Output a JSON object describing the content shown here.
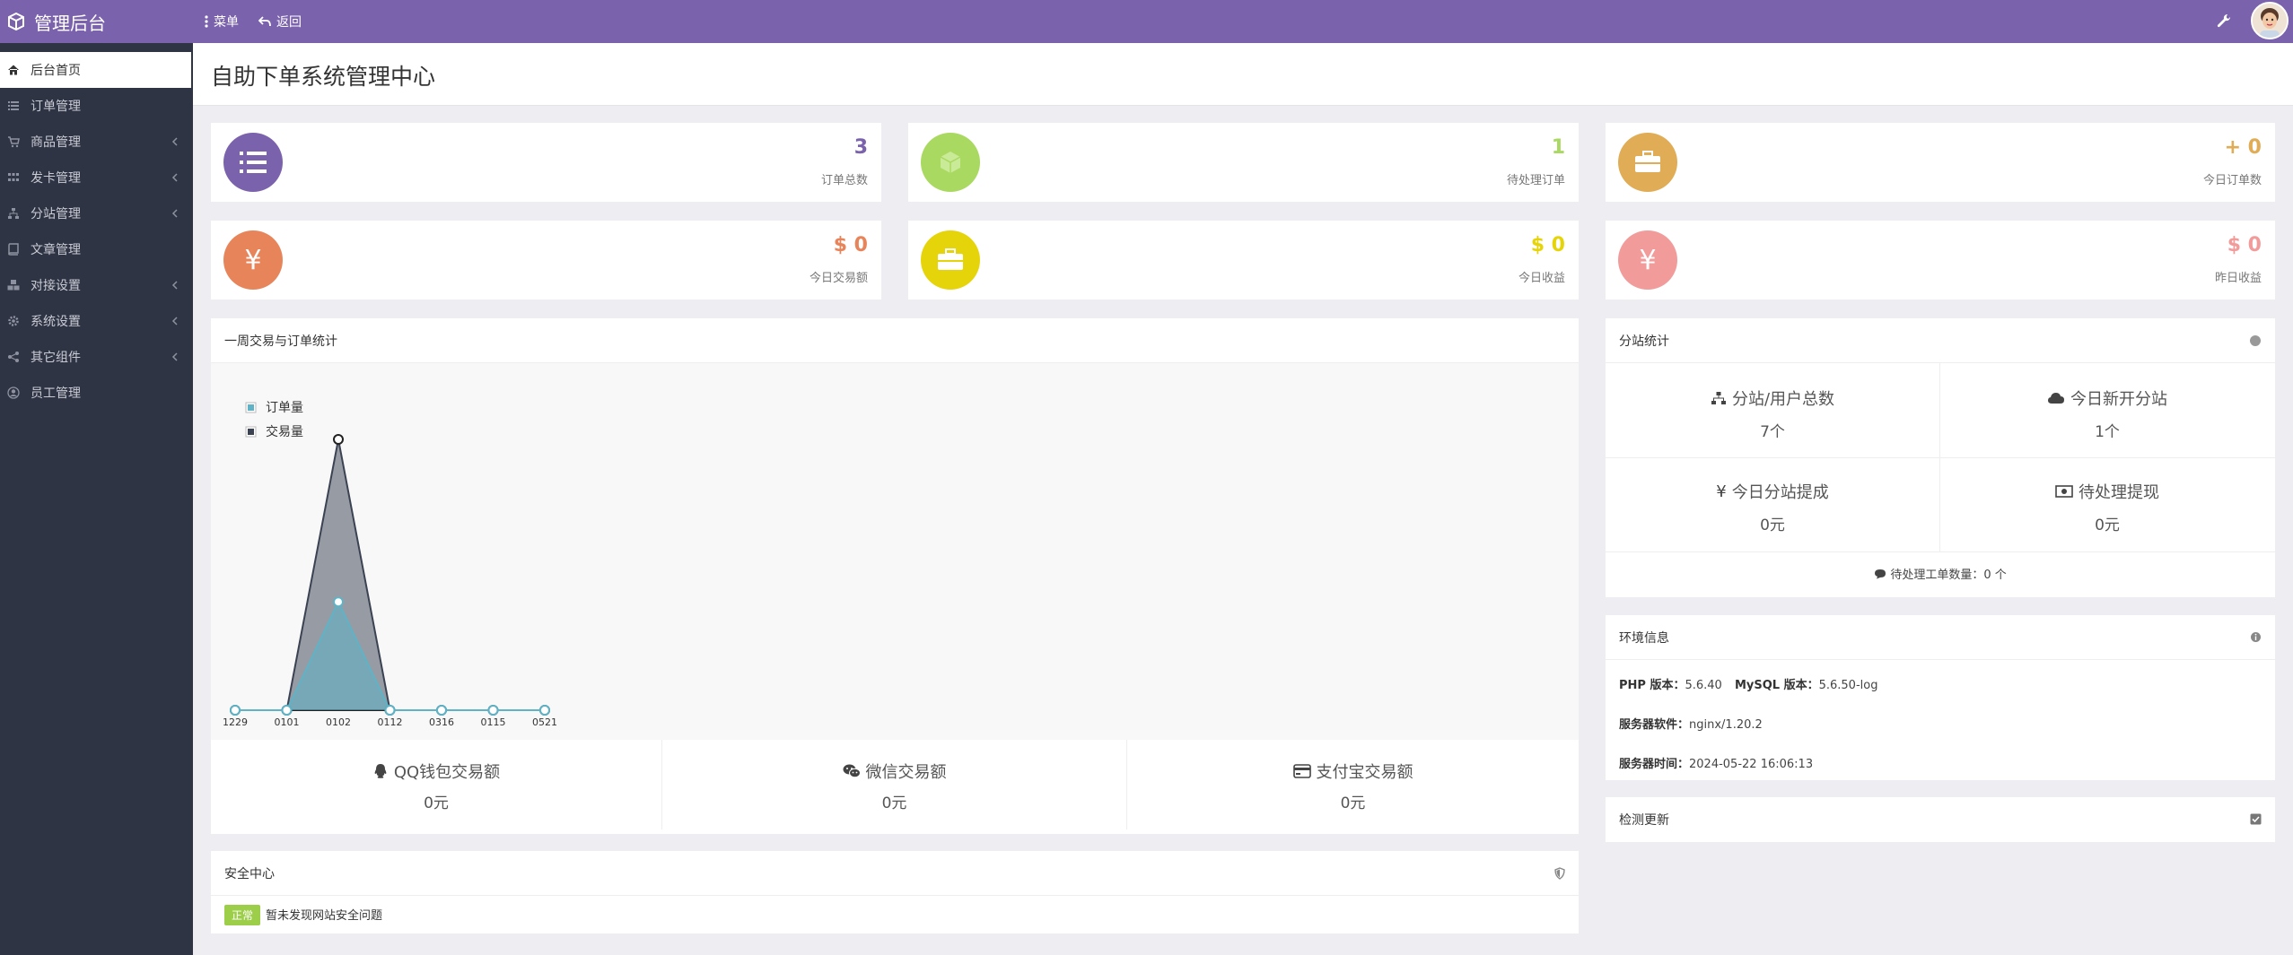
{
  "app": {
    "brand_title": "管理后台"
  },
  "topbar": {
    "menu_label": "菜单",
    "back_label": "返回"
  },
  "sidebar": {
    "items": [
      {
        "label": "后台首页",
        "icon": "home-icon"
      },
      {
        "label": "订单管理",
        "icon": "list-icon"
      },
      {
        "label": "商品管理",
        "icon": "cart-icon"
      },
      {
        "label": "发卡管理",
        "icon": "grid-icon"
      },
      {
        "label": "分站管理",
        "icon": "sitemap-icon"
      },
      {
        "label": "文章管理",
        "icon": "book-icon"
      },
      {
        "label": "对接设置",
        "icon": "cubes-icon"
      },
      {
        "label": "系统设置",
        "icon": "gear-icon"
      },
      {
        "label": "其它组件",
        "icon": "share-icon"
      },
      {
        "label": "员工管理",
        "icon": "user-circle-icon"
      }
    ]
  },
  "page": {
    "title": "自助下单系统管理中心"
  },
  "stats": [
    {
      "value": "3",
      "label": "订单总数",
      "color": "#7b62ac"
    },
    {
      "value": "1",
      "label": "待处理订单",
      "color": "#a9d960"
    },
    {
      "value": "+ 0",
      "label": "今日订单数",
      "color": "#e0ac55"
    },
    {
      "value": "$ 0",
      "label": "今日交易额",
      "color": "#e8845a"
    },
    {
      "value": "$ 0",
      "label": "今日收益",
      "color": "#e6d40a"
    },
    {
      "value": "$ 0",
      "label": "昨日收益",
      "color": "#f29b9b"
    }
  ],
  "chart_panel": {
    "title": "一周交易与订单统计"
  },
  "chart_data": {
    "type": "area",
    "categories": [
      "1229",
      "0101",
      "0102",
      "0112",
      "0316",
      "0115",
      "0521"
    ],
    "series": [
      {
        "name": "订单量",
        "values": [
          0,
          0,
          1,
          0,
          0,
          0,
          0
        ],
        "color": "#5fb3c6"
      },
      {
        "name": "交易量",
        "values": [
          0,
          0,
          2.5,
          0,
          0,
          0,
          0
        ],
        "color": "#3b4252"
      }
    ],
    "ylim": [
      0,
      2.5
    ],
    "legend": "top-left"
  },
  "payments": [
    {
      "label": "QQ钱包交易额",
      "value": "0元",
      "icon": "qq-icon"
    },
    {
      "label": "微信交易额",
      "value": "0元",
      "icon": "wechat-icon"
    },
    {
      "label": "支付宝交易额",
      "value": "0元",
      "icon": "credit-card-icon"
    }
  ],
  "security": {
    "title": "安全中心",
    "badge": "正常",
    "message": "暂未发现网站安全问题"
  },
  "substation": {
    "title": "分站统计",
    "cells": [
      {
        "label": "分站/用户总数",
        "value": "7个",
        "icon": "sitemap-icon"
      },
      {
        "label": "今日新开分站",
        "value": "1个",
        "icon": "cloud-icon"
      },
      {
        "label": "今日分站提成",
        "value": "0元",
        "icon": "yen-icon"
      },
      {
        "label": "待处理提现",
        "value": "0元",
        "icon": "money-icon"
      }
    ],
    "ticket_label": "待处理工单数量：",
    "ticket_value": "0 个"
  },
  "env": {
    "title": "环境信息",
    "php_label": "PHP 版本：",
    "php_value": "5.6.40",
    "mysql_label": "MySQL 版本：",
    "mysql_value": "5.6.50-log",
    "server_label": "服务器软件：",
    "server_value": "nginx/1.20.2",
    "time_label": "服务器时间：",
    "time_value": "2024-05-22 16:06:13"
  },
  "update": {
    "title": "检测更新"
  }
}
